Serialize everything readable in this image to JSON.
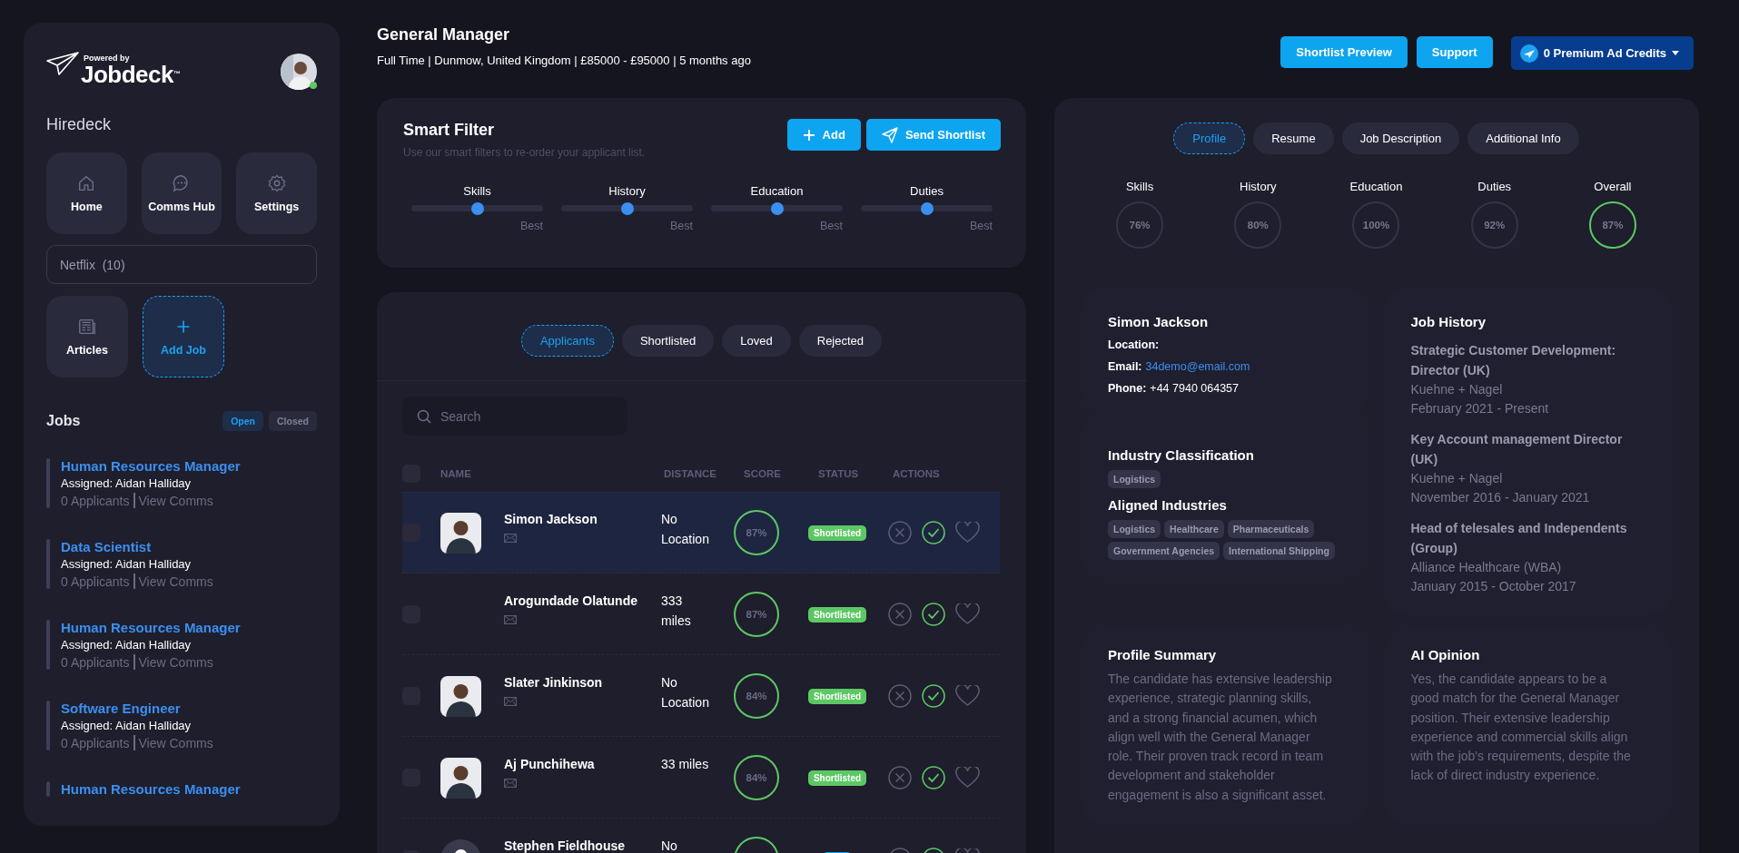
{
  "sidebar": {
    "logo": {
      "caption": "Powered by",
      "name": "Jobdeck",
      "mark": "™"
    },
    "user": {
      "online": true
    },
    "title": "Hiredeck",
    "tiles": [
      {
        "label": "Home",
        "kind": "home"
      },
      {
        "label": "Comms Hub",
        "kind": "chat"
      },
      {
        "label": "Settings",
        "kind": "gear"
      }
    ],
    "company_select": {
      "value": "Netflix  (10)"
    },
    "tiles_2": [
      {
        "label": "Articles",
        "kind": "news"
      },
      {
        "label": "Add Job",
        "kind": "add"
      }
    ],
    "jobs_title": "Jobs",
    "job_filters": [
      {
        "label": "Open",
        "selected": true
      },
      {
        "label": "Closed",
        "selected": false
      }
    ],
    "jobs": [
      {
        "title": "Human Resources Manager",
        "assigned": "Assigned: Aidan Halliday",
        "applicants": "0 Applicants",
        "link": "View Comms"
      },
      {
        "title": "Data Scientist",
        "assigned": "Assigned: Aidan Halliday",
        "applicants": "0 Applicants",
        "link": "View Comms"
      },
      {
        "title": "Human Resources Manager",
        "assigned": "Assigned: Aidan Halliday",
        "applicants": "0 Applicants",
        "link": "View Comms"
      },
      {
        "title": "Software Engineer",
        "assigned": "Assigned: Aidan Halliday",
        "applicants": "0 Applicants",
        "link": "View Comms"
      },
      {
        "title": "Human Resources Manager"
      }
    ]
  },
  "header": {
    "title": "General Manager",
    "meta": "Full Time | Dunmow, United Kingdom | £85000 - £95000 | 5 months ago",
    "buttons": [
      "Shortlist Preview",
      "Support"
    ],
    "credits": "0 Premium Ad Credits"
  },
  "smart_filter": {
    "title": "Smart Filter",
    "subtitle": "Use our smart filters to re-order your applicant list.",
    "buttons": [
      {
        "label": "Add",
        "kind": "plus"
      },
      {
        "label": "Send Shortlist",
        "kind": "send"
      }
    ],
    "sliders": [
      {
        "label": "Skills",
        "level": 0.5,
        "end_label": "Best"
      },
      {
        "label": "History",
        "level": 0.5,
        "end_label": "Best"
      },
      {
        "label": "Education",
        "level": 0.5,
        "end_label": "Best"
      },
      {
        "label": "Duties",
        "level": 0.5,
        "end_label": "Best"
      }
    ]
  },
  "applicants": {
    "tabs": [
      {
        "label": "Applicants",
        "selected": true
      },
      {
        "label": "Shortlisted",
        "selected": false
      },
      {
        "label": "Loved",
        "selected": false
      },
      {
        "label": "Rejected",
        "selected": false
      }
    ],
    "search": {
      "placeholder": "Search"
    },
    "select_all": {
      "checked": false
    },
    "columns": [
      "NAME",
      "DISTANCE",
      "SCORE",
      "STATUS",
      "ACTIONS"
    ],
    "rows": [
      {
        "name": "Simon Jackson",
        "distance": "No Location",
        "score": "87%",
        "status": {
          "label": "Shortlisted",
          "color": "#5cc864"
        },
        "checked": false,
        "selected": true
      },
      {
        "name": "Arogundade Olatunde",
        "distance": "333 miles",
        "score": "87%",
        "status": {
          "label": "Shortlisted",
          "color": "#5cc864"
        },
        "checked": false,
        "selected": false
      },
      {
        "name": "Slater Jinkinson",
        "distance": "No Location",
        "score": "84%",
        "status": {
          "label": "Shortlisted",
          "color": "#5cc864"
        },
        "checked": false,
        "selected": false
      },
      {
        "name": "Aj Punchihewa",
        "distance": "33 miles",
        "score": "84%",
        "status": {
          "label": "Shortlisted",
          "color": "#5cc864"
        },
        "checked": false,
        "selected": false
      },
      {
        "name": "Stephen Fieldhouse",
        "avatar": {
          "kind": "placeholder"
        },
        "distance": "No",
        "status": {
          "color": "#0ea5f0"
        },
        "checked": false,
        "selected": false
      }
    ]
  },
  "profile": {
    "tabs": [
      {
        "label": "Profile",
        "selected": true
      },
      {
        "label": "Resume",
        "selected": false
      },
      {
        "label": "Job Description",
        "selected": false
      },
      {
        "label": "Additional Info",
        "selected": false
      }
    ],
    "scores": [
      {
        "label": "Skills",
        "value": "76%",
        "highlighted": false
      },
      {
        "label": "History",
        "value": "80%",
        "highlighted": false
      },
      {
        "label": "Education",
        "value": "100%",
        "highlighted": false
      },
      {
        "label": "Duties",
        "value": "92%",
        "highlighted": false
      },
      {
        "label": "Overall",
        "value": "87%",
        "highlighted": true
      }
    ],
    "contact": {
      "name": "Simon Jackson",
      "location_label": "Location:",
      "email_label": "Email:",
      "email": "34demo@email.com",
      "phone_label": "Phone:",
      "phone": "+44 7940 064357"
    },
    "industry": {
      "title": "Industry Classification",
      "tags": [
        "Logistics"
      ],
      "aligned_title": "Aligned Industries",
      "aligned_tags": [
        "Logistics",
        "Healthcare",
        "Pharmaceuticals",
        "Government Agencies",
        "International Shipping"
      ]
    },
    "job_history": {
      "title": "Job History",
      "entries": [
        {
          "role": "Strategic Customer Development: Director (UK)",
          "company": "Kuehne + Nagel",
          "dates": "February 2021 - Present"
        },
        {
          "role": "Key Account management Director (UK)",
          "company": "Kuehne + Nagel",
          "dates": "November 2016 - January 2021"
        },
        {
          "role": "Head of telesales and Independents (Group)",
          "company": "Alliance Healthcare (WBA)",
          "dates": "January 2015 - October 2017"
        }
      ]
    },
    "summary": {
      "title": "Profile Summary",
      "text": "The candidate has extensive leadership experience, strategic planning skills, and a strong financial acumen, which align well with the General Manager role. Their proven track record in team development and stakeholder engagement is also a significant asset."
    },
    "opinion": {
      "title": "AI Opinion",
      "text": "Yes, the candidate appears to be a good match for the General Manager position. Their extensive leadership experience and commercial skills align with the job's requirements, despite the lack of direct industry experience."
    }
  }
}
